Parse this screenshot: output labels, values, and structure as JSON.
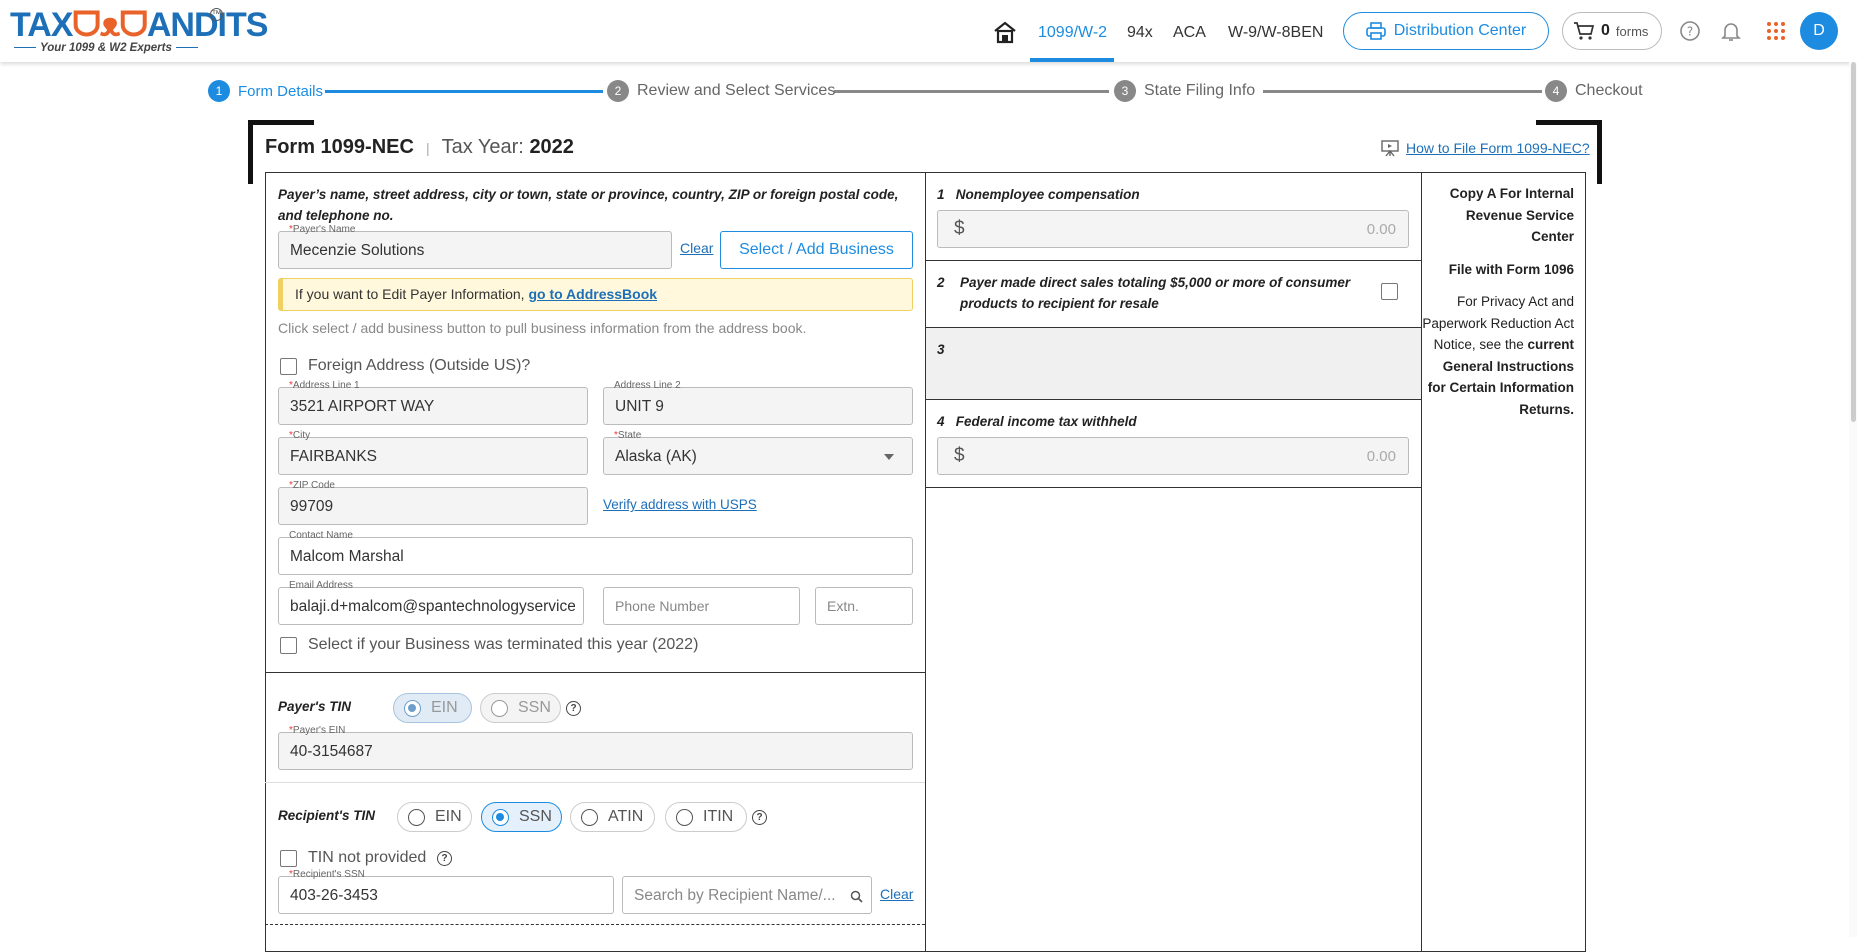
{
  "header": {
    "logo_text_left": "TAX",
    "logo_text_right": "ANDITS",
    "logo_tm": "TM",
    "logo_tagline": "Your 1099 & W2 Experts",
    "nav": [
      "1099/W-2",
      "94x",
      "ACA",
      "W-9/W-8BEN"
    ],
    "distribution_center": "Distribution Center",
    "cart_count": "0",
    "cart_label": "forms",
    "avatar_initial": "D"
  },
  "stepper": [
    {
      "num": "1",
      "label": "Form Details"
    },
    {
      "num": "2",
      "label": "Review and Select Services"
    },
    {
      "num": "3",
      "label": "State Filing Info"
    },
    {
      "num": "4",
      "label": "Checkout"
    }
  ],
  "form": {
    "title": "Form 1099-NEC",
    "tax_year_label": "Tax Year:",
    "tax_year": "2022",
    "how_to_link": "How to File Form 1099-NEC?"
  },
  "payer": {
    "section_label": "Payer’s name, street address, city or town, state or province, country, ZIP or foreign postal code, and telephone no.",
    "name_label": "Payer's Name",
    "name_value": "Mecenzie Solutions",
    "clear_link": "Clear",
    "select_button": "Select / Add Business",
    "notice_text": "If you want to Edit Payer Information, ",
    "notice_link": "go to AddressBook",
    "hint": "Click select / add business button to pull business information from the address book.",
    "foreign_label": "Foreign Address (Outside US)?",
    "address1_label": "Address Line 1",
    "address1_value": "3521 AIRPORT WAY",
    "address2_label": "Address Line 2",
    "address2_value": "UNIT 9",
    "city_label": "City",
    "city_value": "FAIRBANKS",
    "state_label": "State",
    "state_value": "Alaska (AK)",
    "zip_label": "ZIP Code",
    "zip_value": "99709",
    "verify_link": "Verify address with USPS",
    "contact_label": "Contact Name",
    "contact_value": "Malcom Marshal",
    "email_label": "Email Address",
    "email_value": "balaji.d+malcom@spantechnologyservices.com",
    "phone_placeholder": "Phone Number",
    "ext_placeholder": "Extn.",
    "terminated_label": "Select if your Business was terminated this year (2022)"
  },
  "payer_tin": {
    "label": "Payer's TIN",
    "options": [
      "EIN",
      "SSN"
    ],
    "selected": "EIN",
    "ein_label": "Payer's EIN",
    "ein_value": "40-3154687"
  },
  "recipient_tin": {
    "label": "Recipient's TIN",
    "options": [
      "EIN",
      "SSN",
      "ATIN",
      "ITIN"
    ],
    "selected": "SSN",
    "not_provided_label": "TIN not provided",
    "ssn_label": "Recipient's SSN",
    "ssn_value": "403-26-3453",
    "search_placeholder": "Search by Recipient Name/...",
    "clear_link": "Clear"
  },
  "boxes": {
    "box1_num": "1",
    "box1_label": "Nonemployee compensation",
    "box1_value": "0.00",
    "box2_num": "2",
    "box2_label": "Payer made direct sales totaling $5,000 or more of consumer products to recipient for resale",
    "box3_num": "3",
    "box4_num": "4",
    "box4_label": "Federal income tax withheld",
    "box4_value": "0.00",
    "currency": "$"
  },
  "copy_info": {
    "line1": "Copy A For Internal Revenue Service Center",
    "line2": "File with Form 1096",
    "line3_plain": "For Privacy Act and Paperwork Reduction Act Notice, see the",
    "line3_bold": "current General Instructions for Certain Information Returns."
  },
  "colors": {
    "accent": "#1d8ce0",
    "brand": "#1d6fb8",
    "owl": "#e8622a",
    "notice_bg": "#fff8dc"
  }
}
